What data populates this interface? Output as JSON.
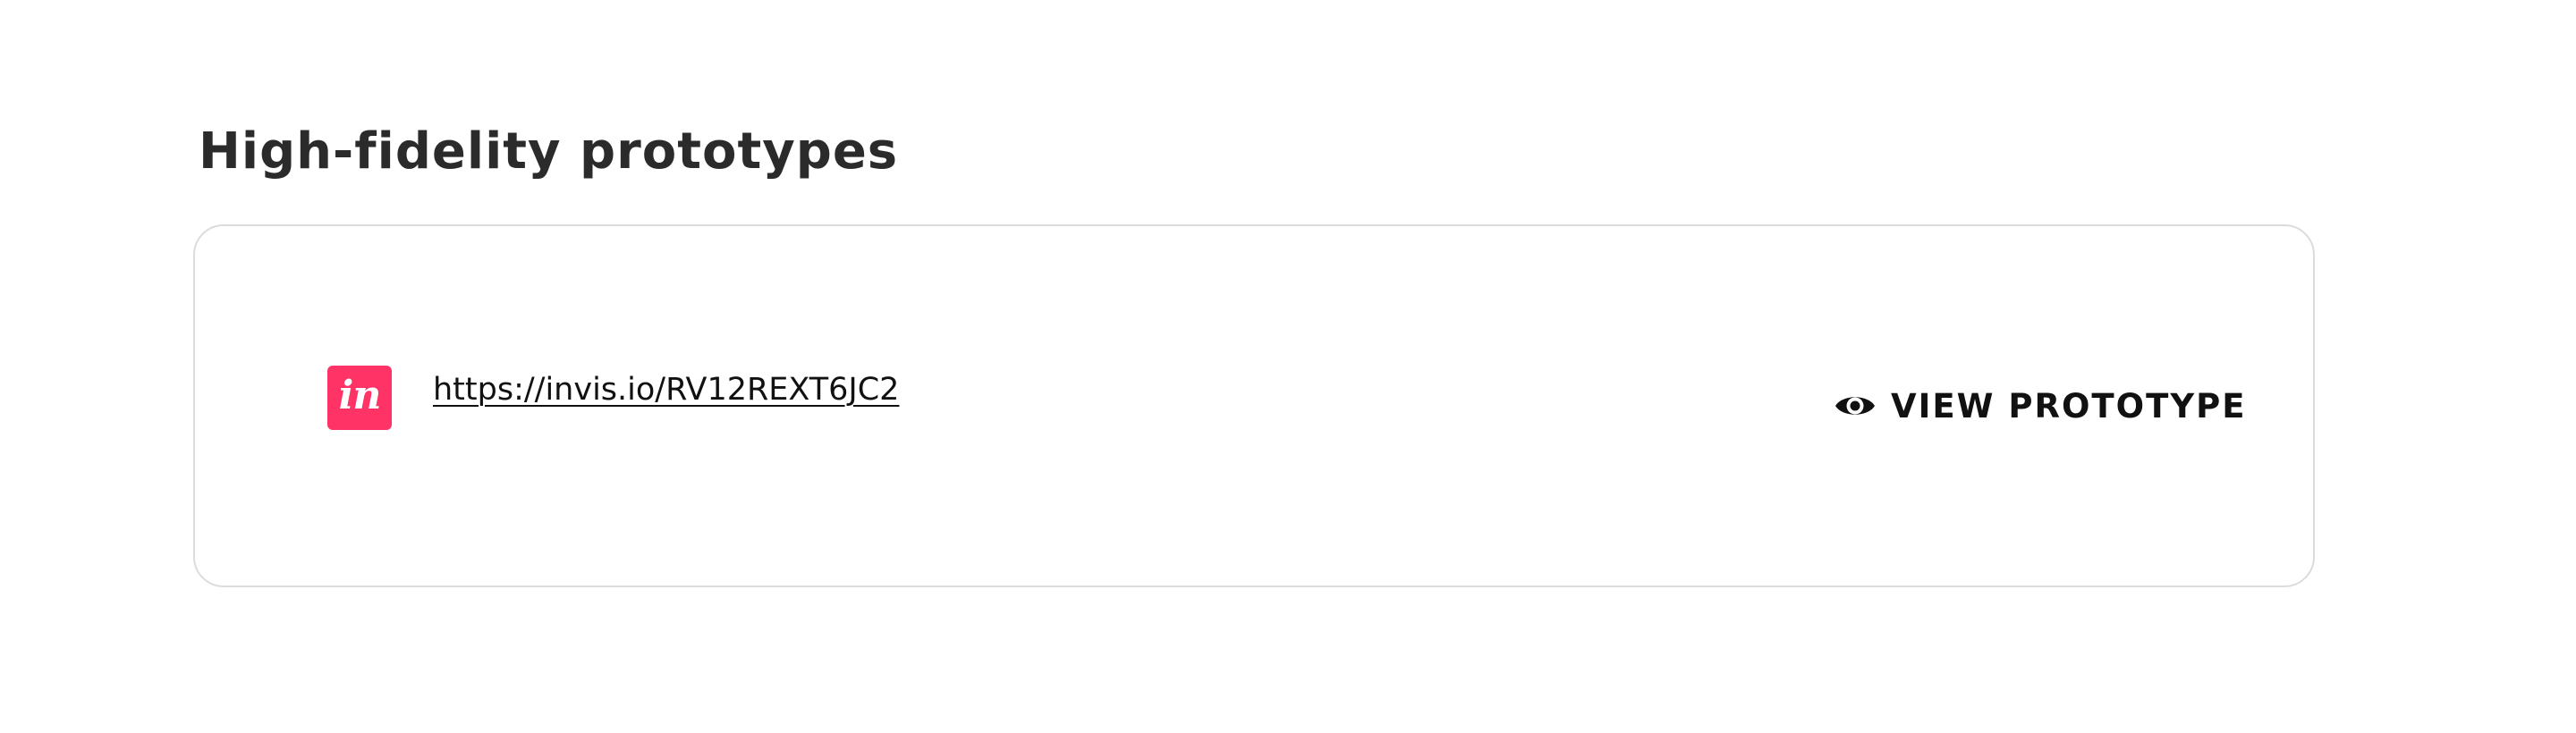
{
  "section": {
    "title": "High-fidelity prototypes"
  },
  "prototype": {
    "brand_logo_text": "in",
    "brand_color": "#ff3366",
    "link_text": "https://invis.io/RV12REXT6JC2",
    "view_button_label": "VIEW PROTOTYPE",
    "view_button_icon": "eye-icon"
  }
}
